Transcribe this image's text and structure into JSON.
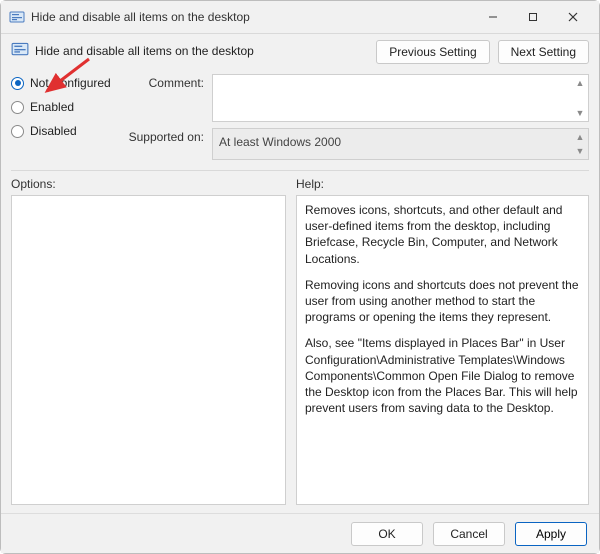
{
  "window": {
    "title": "Hide and disable all items on the desktop"
  },
  "header": {
    "subtitle": "Hide and disable all items on the desktop",
    "prev_btn": "Previous Setting",
    "next_btn": "Next Setting"
  },
  "state": {
    "not_configured": "Not Configured",
    "enabled": "Enabled",
    "disabled": "Disabled",
    "selected": "not_configured"
  },
  "fields": {
    "comment_label": "Comment:",
    "comment_value": "",
    "supported_label": "Supported on:",
    "supported_value": "At least Windows 2000"
  },
  "lower": {
    "options_label": "Options:",
    "help_label": "Help:",
    "help_p1": "Removes icons, shortcuts, and other default and user-defined items from the desktop, including Briefcase, Recycle Bin, Computer, and Network Locations.",
    "help_p2": "Removing icons and shortcuts does not prevent the user from using another method to start the programs or opening the items they represent.",
    "help_p3": "Also, see \"Items displayed in Places Bar\" in User Configuration\\Administrative Templates\\Windows Components\\Common Open File Dialog to remove the Desktop icon from the Places Bar. This will help prevent users from saving data to the Desktop."
  },
  "footer": {
    "ok": "OK",
    "cancel": "Cancel",
    "apply": "Apply"
  }
}
